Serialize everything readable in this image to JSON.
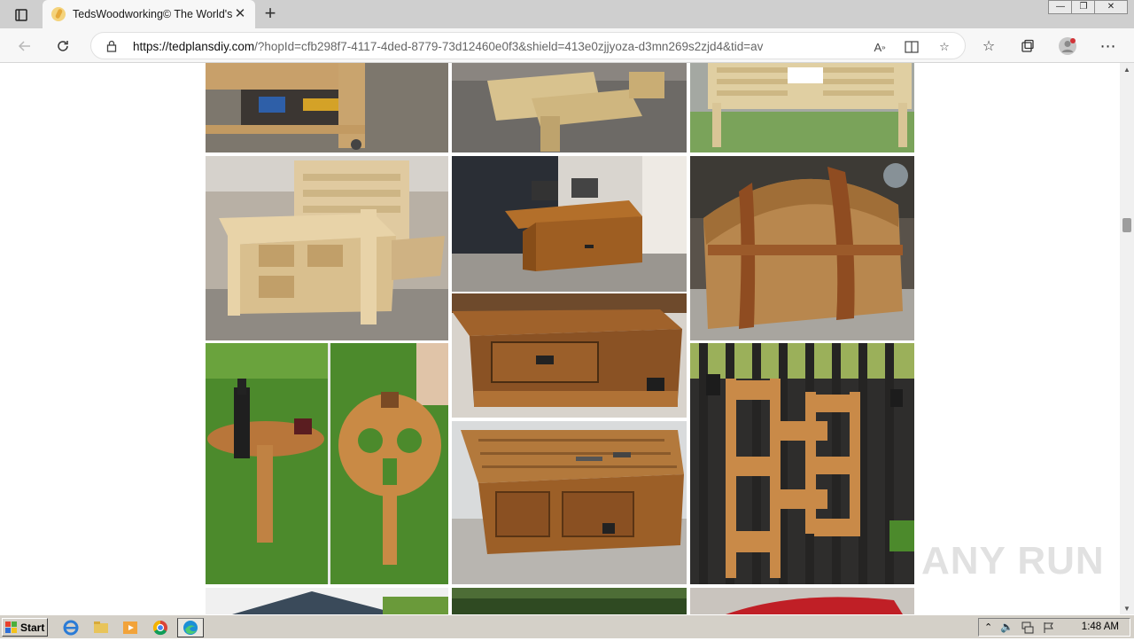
{
  "tab": {
    "title": "TedsWoodworking© The World's"
  },
  "address": {
    "host": "https://tedplansdiy.com",
    "path": "/?hopId=cfb298f7-4117-4ded-8779-73d12460e0f3&shield=413e0zjjyoza-d3mn269s2zjd4&tid=av"
  },
  "gallery": {
    "items": [
      "workbench-cart",
      "picnic-bench",
      "double-chair-bench",
      "storage-bed-frame",
      "lift-top-coffee-table",
      "treasure-chest",
      "wine-table",
      "trunk-coffee-table",
      "vertical-planter",
      "woodworking-workbench"
    ]
  },
  "taskbar": {
    "start_label": "Start",
    "clock": "1:48 AM"
  },
  "watermark": "ANY RUN"
}
